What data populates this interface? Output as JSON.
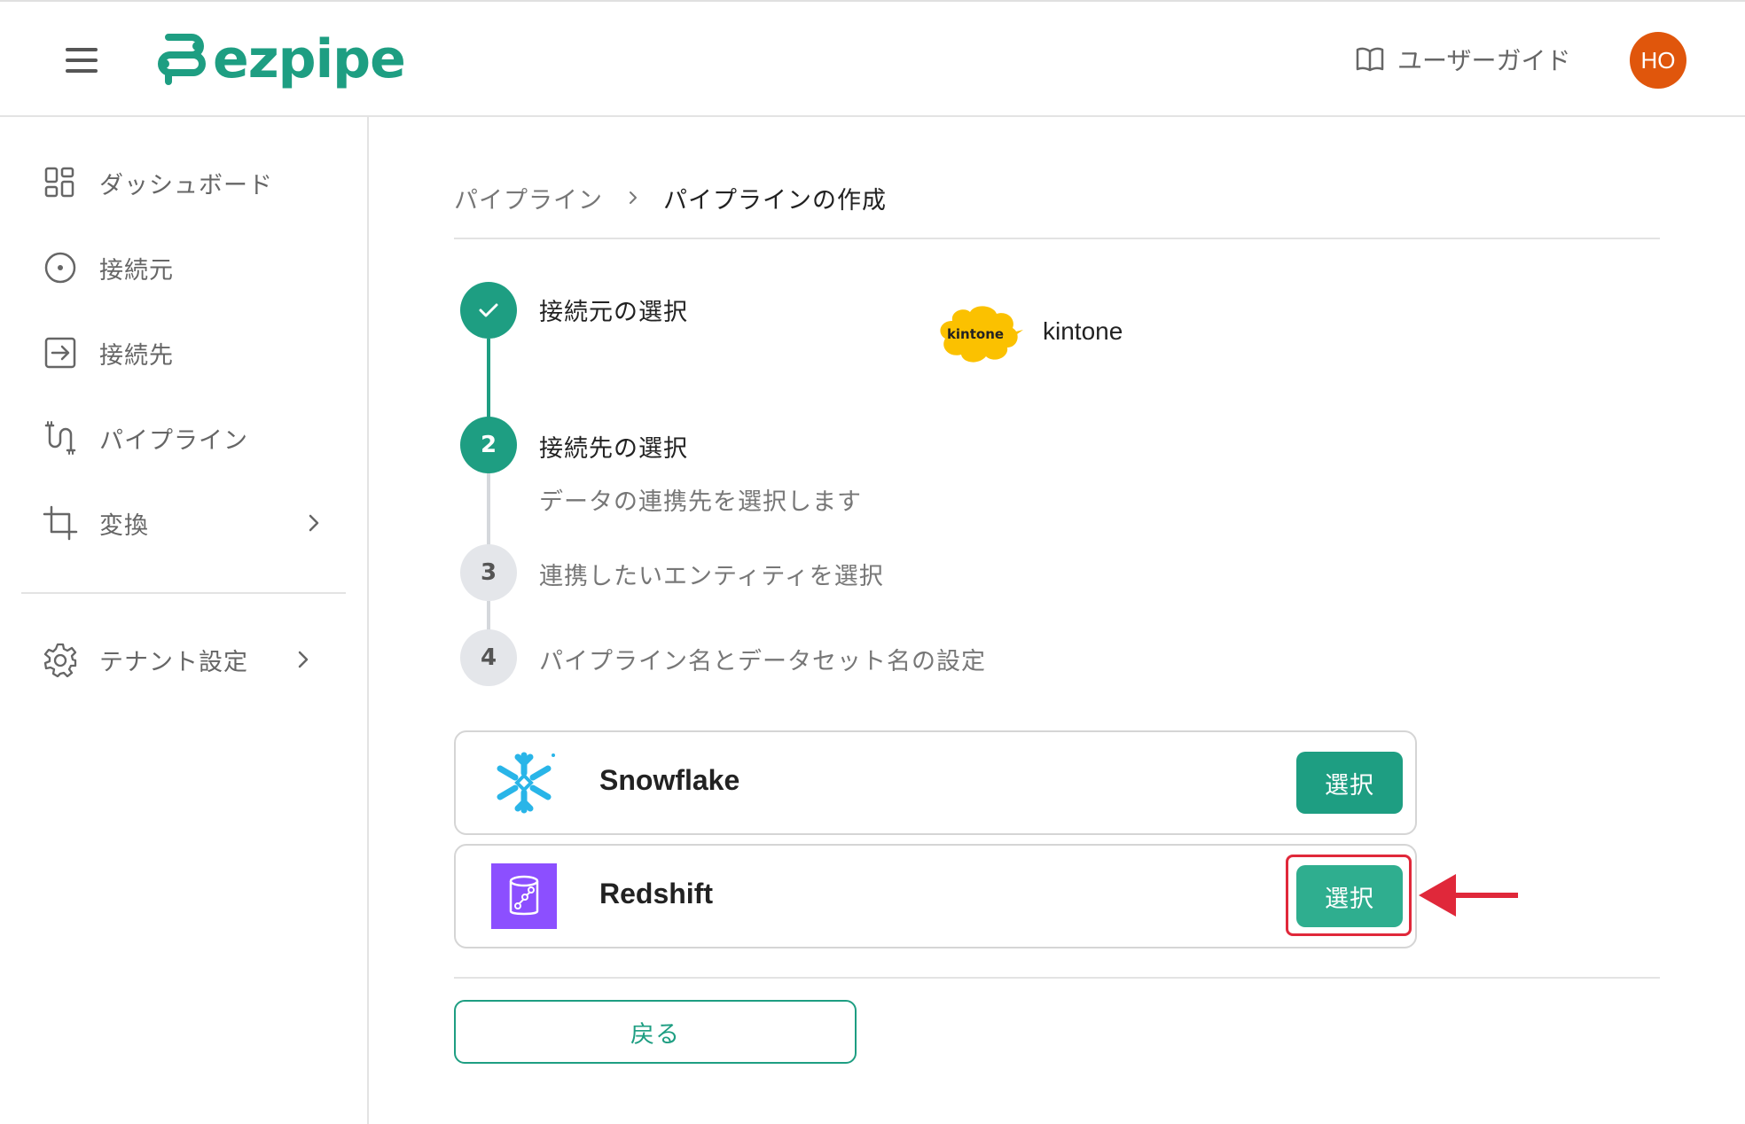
{
  "app": {
    "name": "ezpipe",
    "user_initials": "HO",
    "guide_label": "ユーザーガイド"
  },
  "colors": {
    "brand": "#1e9e82",
    "avatar": "#e0560c",
    "highlight": "#e0283a"
  },
  "sidebar": {
    "items": [
      {
        "label": "ダッシュボード",
        "icon": "dashboard-grid-icon"
      },
      {
        "label": "接続元",
        "icon": "circle-dot-icon"
      },
      {
        "label": "接続先",
        "icon": "arrow-into-box-icon"
      },
      {
        "label": "パイプライン",
        "icon": "pipeline-icon"
      },
      {
        "label": "変換",
        "icon": "crop-icon"
      },
      {
        "label": "テナント設定",
        "icon": "gear-icon"
      }
    ]
  },
  "breadcrumb": {
    "parent": "パイプライン",
    "current": "パイプラインの作成"
  },
  "steps": [
    {
      "number": "",
      "title": "接続元の選択",
      "status": "done"
    },
    {
      "number": "2",
      "title": "接続先の選択",
      "description": "データの連携先を選択します",
      "status": "active"
    },
    {
      "number": "3",
      "title": "連携したいエンティティを選択",
      "status": "pending"
    },
    {
      "number": "4",
      "title": "パイプライン名とデータセット名の設定",
      "status": "pending"
    }
  ],
  "source": {
    "logo_text": "kintone",
    "name": "kintone"
  },
  "destinations": [
    {
      "name": "Snowflake",
      "button": "選択",
      "icon": "snowflake-logo-icon"
    },
    {
      "name": "Redshift",
      "button": "選択",
      "icon": "redshift-logo-icon"
    }
  ],
  "back_label": "戻る"
}
